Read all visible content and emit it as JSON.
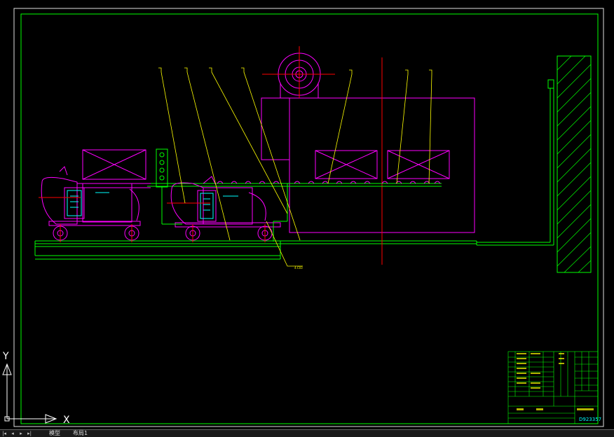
{
  "drawing": {
    "scale_label": "4.C03",
    "title_block": {
      "drawing_name": "",
      "drawing_number": "D923357"
    },
    "colors": {
      "background": "#000000",
      "frame": "#00ff00",
      "magenta": "#ff00ff",
      "yellow": "#ffff00",
      "red": "#ff0000",
      "cyan": "#00ffff",
      "white": "#ffffff"
    }
  },
  "ucs": {
    "x_label": "X",
    "y_label": "Y"
  },
  "tabs": [
    {
      "label": "模型"
    },
    {
      "label": "布局1"
    }
  ]
}
